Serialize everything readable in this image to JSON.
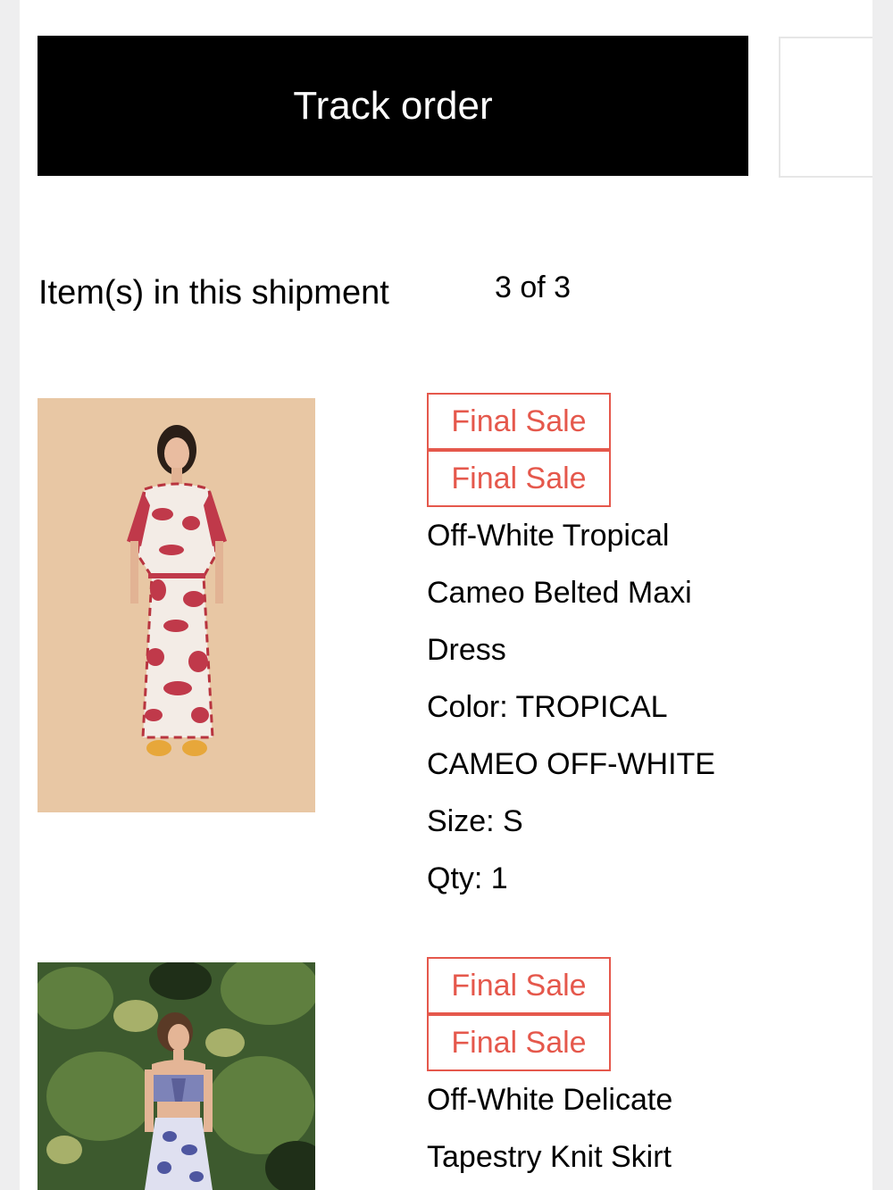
{
  "track_order_label": "Track order",
  "shipment": {
    "title": "Item(s) in this shipment",
    "count": "3 of 3"
  },
  "items": [
    {
      "badges": [
        "Final Sale",
        "Final Sale"
      ],
      "name_lines": [
        "Off-White Tropical",
        "Cameo Belted Maxi",
        "Dress"
      ],
      "color_lines": [
        "Color: TROPICAL",
        "CAMEO OFF-WHITE"
      ],
      "size": "Size: S",
      "qty": "Qty: 1"
    },
    {
      "badges": [
        "Final Sale",
        "Final Sale"
      ],
      "name_lines": [
        "Off-White Delicate",
        "Tapestry Knit Skirt"
      ]
    }
  ],
  "colors": {
    "accent_red": "#e5584c",
    "button_black": "#000000"
  }
}
